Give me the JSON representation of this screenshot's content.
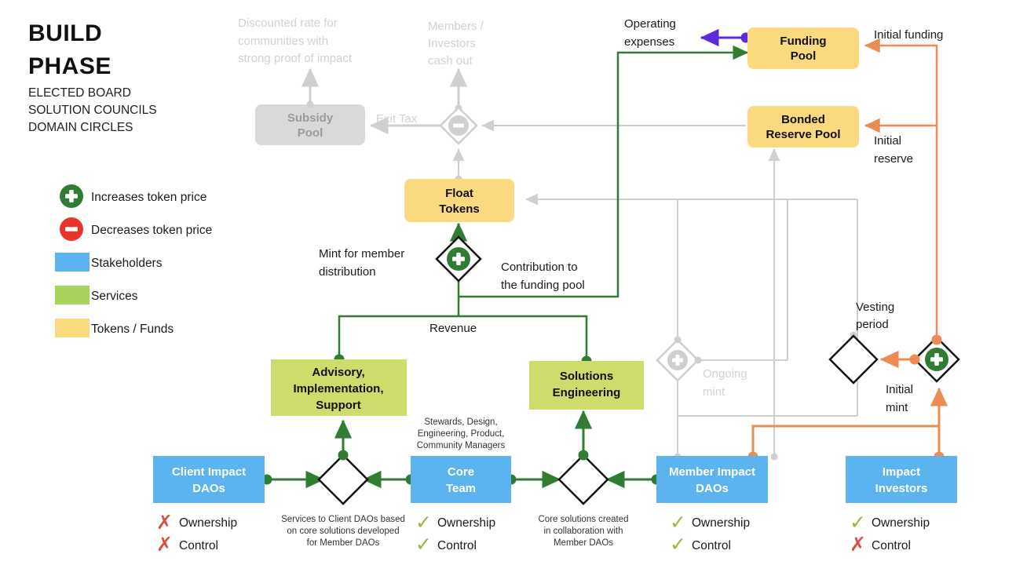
{
  "title": {
    "line1": "BUILD",
    "line2": "PHASE"
  },
  "subtitle": {
    "l1": "ELECTED BOARD",
    "l2": "SOLUTION COUNCILS",
    "l3": "DOMAIN CIRCLES"
  },
  "legend": {
    "items": [
      {
        "icon": "plus-circle-icon",
        "label": "Increases token price",
        "color": "#2E7D32"
      },
      {
        "icon": "minus-circle-icon",
        "label": "Decreases token price",
        "color": "#E8342A"
      },
      {
        "icon": "color-swatch-blue",
        "label": "Stakeholders",
        "color": "#5BB4F0"
      },
      {
        "icon": "color-swatch-green",
        "label": "Services",
        "color": "#A8D25C"
      },
      {
        "icon": "color-swatch-yellow",
        "label": "Tokens / Funds",
        "color": "#FAD97F"
      }
    ]
  },
  "colors": {
    "stakeholder": "#5BB4F0",
    "service": "#CDDC6A",
    "tokens": "#FAD97F",
    "muted": "#D9D9D9",
    "green_edge": "#2E7D32",
    "orange_edge": "#ED8B55",
    "purple_edge": "#5B2BD9",
    "grey_edge": "#D2D2D2",
    "check": "#96B93B",
    "cross": "#D94F44"
  },
  "nodes": {
    "subsidy_pool": {
      "label1": "Subsidy",
      "label2": "Pool",
      "kind": "tokens-muted"
    },
    "float_tokens": {
      "label1": "Float",
      "label2": "Tokens",
      "kind": "tokens"
    },
    "funding_pool": {
      "label1": "Funding",
      "label2": "Pool",
      "kind": "tokens"
    },
    "bonded_reserve_pool": {
      "label1": "Bonded",
      "label2": "Reserve Pool",
      "kind": "tokens"
    },
    "advisory": {
      "label1": "Advisory,",
      "label2": "Implementation,",
      "label3": "Support",
      "kind": "service"
    },
    "solutions_engineering": {
      "label1": "Solutions",
      "label2": "Engineering",
      "kind": "service"
    },
    "client_impact_daos": {
      "label1": "Client Impact",
      "label2": "DAOs",
      "kind": "stakeholder"
    },
    "core_team": {
      "label1": "Core",
      "label2": "Team",
      "kind": "stakeholder"
    },
    "member_impact_daos": {
      "label1": "Member Impact",
      "label2": "DAOs",
      "kind": "stakeholder"
    },
    "impact_investors": {
      "label1": "Impact",
      "label2": "Investors",
      "kind": "stakeholder"
    }
  },
  "edge_labels": {
    "discounted_rate": "Discounted rate for communities with strong proof of impact",
    "discounted_rate_l1": "Discounted rate for",
    "discounted_rate_l2": "communities with",
    "discounted_rate_l3": "strong proof of impact",
    "members_cash_out_l1": "Members  /",
    "members_cash_out_l2": "Investors",
    "members_cash_out_l3": "cash out",
    "exit_tax": "Exit Tax",
    "operating_expenses_l1": "Operating",
    "operating_expenses_l2": "expenses",
    "initial_funding": "Initial funding",
    "initial_reserve_l1": "Initial",
    "initial_reserve_l2": "reserve",
    "mint_for_member_l1": "Mint for member",
    "mint_for_member_l2": "distribution",
    "contribution_l1": "Contribution to",
    "contribution_l2": "the funding pool",
    "revenue": "Revenue",
    "vesting_period_l1": "Vesting",
    "vesting_period_l2": "period",
    "initial_mint_l1": "Initial",
    "initial_mint_l2": "mint",
    "ongoing_mint_l1": "Ongoing",
    "ongoing_mint_l2": "mint"
  },
  "annotations": {
    "core_team_roles_l1": "Stewards, Design,",
    "core_team_roles_l2": "Engineering, Product,",
    "core_team_roles_l3": "Community Managers",
    "client_services_l1": "Services to Client DAOs based",
    "client_services_l2": "on core solutions developed",
    "client_services_l3": "for Member DAOs",
    "core_solutions_l1": "Core solutions created",
    "core_solutions_l2": "in collaboration with",
    "core_solutions_l3": "Member DAOs"
  },
  "ownership_control": {
    "ownership_label": "Ownership",
    "control_label": "Control",
    "check_glyph": "✓",
    "cross_glyph": "✗",
    "client_impact_daos": {
      "ownership": "cross",
      "control": "cross"
    },
    "core_team": {
      "ownership": "check",
      "control": "check"
    },
    "member_impact_daos": {
      "ownership": "check",
      "control": "check"
    },
    "impact_investors": {
      "ownership": "check",
      "control": "cross"
    }
  }
}
